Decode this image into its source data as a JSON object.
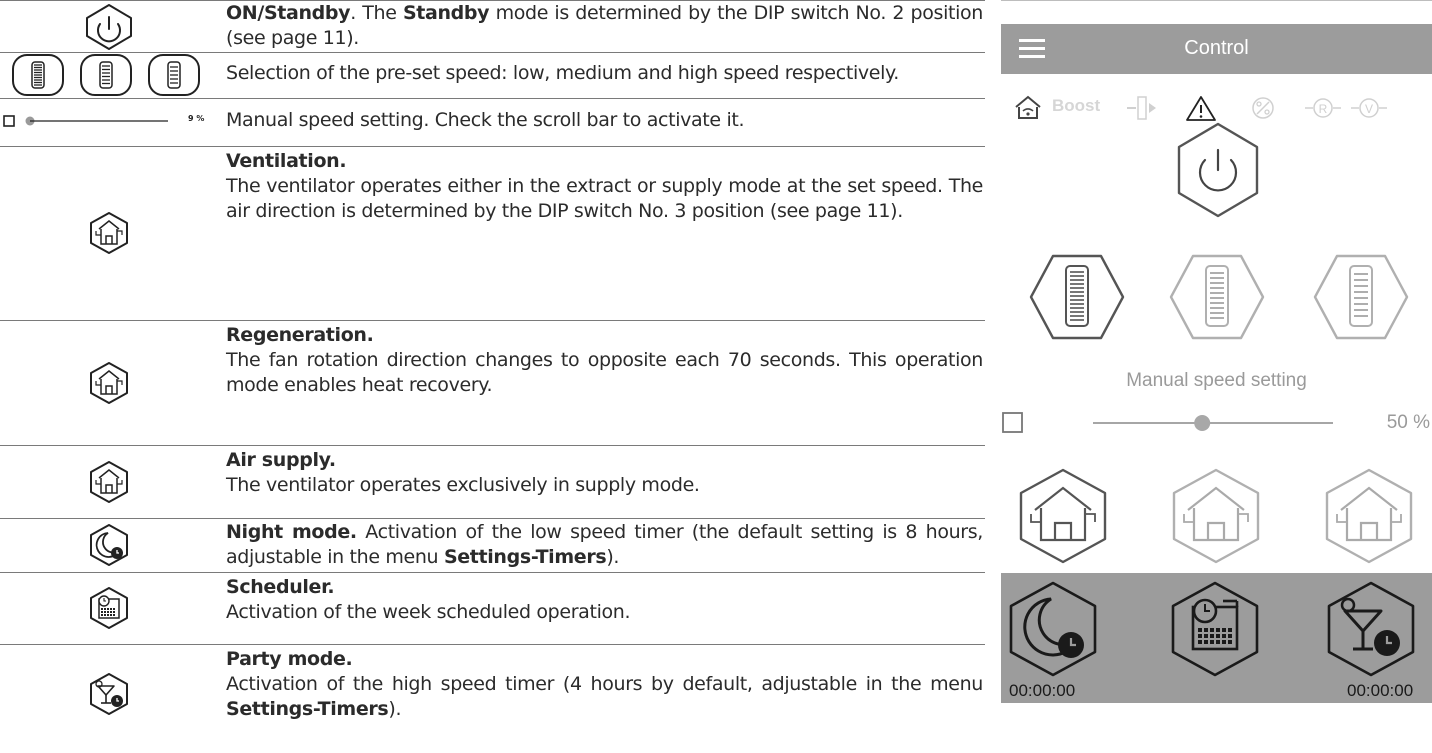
{
  "doc": {
    "rows": [
      {
        "parts": [
          {
            "b": "ON/Standby"
          },
          {
            "t": ". The "
          },
          {
            "b": "Standby"
          },
          {
            "t": " mode is determined by the DIP switch No. 2 position (see page 11)."
          }
        ]
      },
      {
        "parts": [
          {
            "t": "Selection of the pre-set speed: low, medium and high speed respectively."
          }
        ]
      },
      {
        "parts": [
          {
            "t": "Manual speed setting. Check the scroll bar to activate it."
          }
        ]
      },
      {
        "parts": [
          {
            "b": "Ventilation."
          },
          {
            "br": true
          },
          {
            "t": "The ventilator operates either in the extract or supply mode at the set speed. The air direction is determined by the DIP switch No. 3 position (see page 11)."
          }
        ]
      },
      {
        "parts": [
          {
            "b": "Regeneration."
          },
          {
            "br": true
          },
          {
            "t": "The fan rotation direction changes to opposite each 70 seconds. This operation mode enables heat recovery."
          }
        ]
      },
      {
        "parts": [
          {
            "b": "Air supply."
          },
          {
            "br": true
          },
          {
            "t": "The ventilator operates exclusively in supply mode."
          }
        ]
      },
      {
        "parts": [
          {
            "b": "Night mode."
          },
          {
            "t": " Activation of the low speed timer (the default setting is 8 hours, adjustable in the menu "
          },
          {
            "b": "Settings-Timers"
          },
          {
            "t": ")."
          }
        ]
      },
      {
        "parts": [
          {
            "b": "Scheduler."
          },
          {
            "br": true
          },
          {
            "t": "Activation of the week scheduled operation."
          }
        ]
      },
      {
        "parts": [
          {
            "b": "Party mode."
          },
          {
            "br": true
          },
          {
            "t": "Activation of the high speed timer (4 hours by default, adjustable in the menu "
          },
          {
            "b": "Settings-Timers"
          },
          {
            "t": ")."
          }
        ]
      }
    ],
    "slider_icon": {
      "percent_label": "9 %",
      "value": 0.0
    }
  },
  "app": {
    "title": "Control",
    "status_bar": {
      "boost_label": "Boost"
    },
    "manual_speed_label": "Manual speed setting",
    "manual_speed_value": "50 %",
    "manual_speed_fraction": 0.5,
    "timers": {
      "night": "00:00:00",
      "party": "00:00:00"
    }
  },
  "colors": {
    "header": "#9c9c9c",
    "timer_strip": "#9c9c9c",
    "active": "#222222",
    "inactive": "#b0b0b0",
    "text": "#2b2b2b"
  }
}
